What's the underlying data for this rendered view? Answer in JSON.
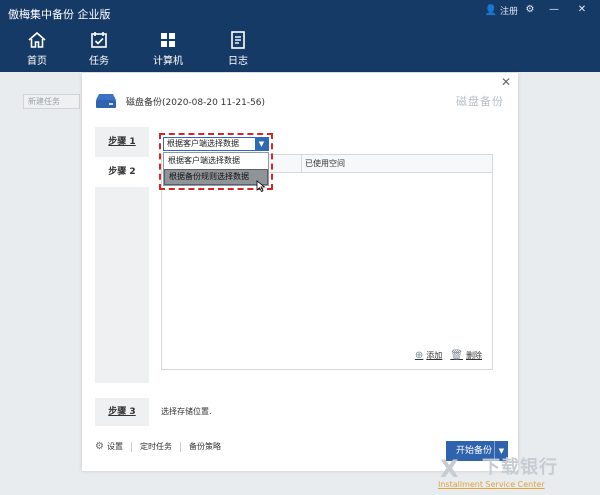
{
  "app": {
    "title": "傲梅集中备份 企业版",
    "user_label": "注册",
    "colors": {
      "header_bg": "#163a66",
      "accent": "#2f63ad",
      "highlight_border": "#d5242a"
    }
  },
  "nav": {
    "items": [
      {
        "label": "首页",
        "icon": "home-icon"
      },
      {
        "label": "任务",
        "icon": "task-icon"
      },
      {
        "label": "计算机",
        "icon": "computer-icon"
      },
      {
        "label": "日志",
        "icon": "log-icon"
      }
    ]
  },
  "background": {
    "new_task_placeholder": "新建任务"
  },
  "dialog": {
    "title": "磁盘备份(2020-08-20 11-21-56)",
    "watermark": "磁盘备份",
    "close_symbol": "✕",
    "steps": [
      {
        "label": "步骤 1"
      },
      {
        "label": "步骤 2"
      },
      {
        "label": "步骤 3"
      }
    ],
    "step3_text": "选择存储位置.",
    "dropdown": {
      "selected": "根据客户端选择数据",
      "options": [
        "根据客户端选择数据",
        "根据备份规则选择数据"
      ],
      "hovered_index": 1
    },
    "table": {
      "columns": [
        "已使用空间"
      ]
    },
    "actions": {
      "add": "添加",
      "delete": "删除"
    },
    "bottom": {
      "settings": "设置",
      "schedule": "定时任务",
      "strategy": "备份策略"
    },
    "start_button": "开始备份"
  },
  "site_watermark": {
    "logo": "X",
    "name": "下载银行",
    "url": "Installment Service Center"
  }
}
